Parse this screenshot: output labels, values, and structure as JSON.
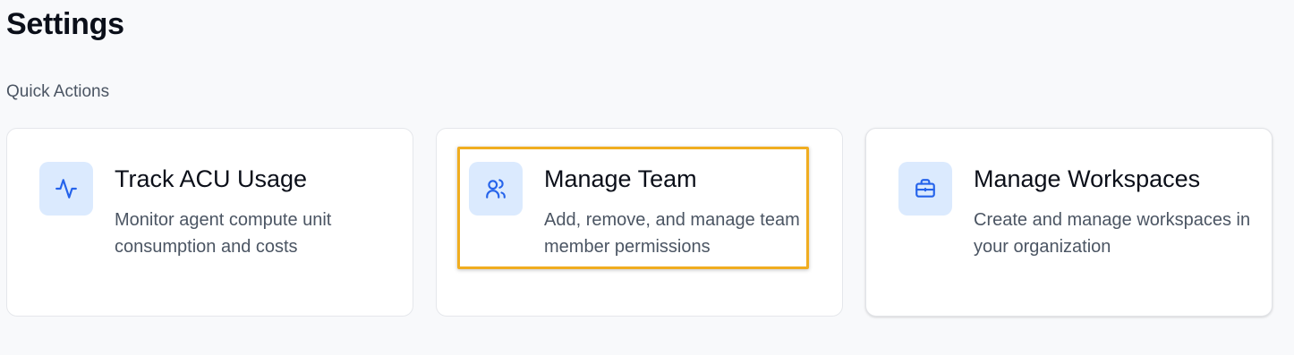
{
  "page": {
    "title": "Settings",
    "section_label": "Quick Actions"
  },
  "cards": [
    {
      "title": "Track ACU Usage",
      "description": "Monitor agent compute unit consumption and costs",
      "icon": "activity-icon"
    },
    {
      "title": "Manage Team",
      "description": "Add, remove, and manage team member permissions",
      "icon": "users-icon"
    },
    {
      "title": "Manage Workspaces",
      "description": "Create and manage workspaces in your organization",
      "icon": "briefcase-icon"
    }
  ],
  "colors": {
    "icon_tile_bg": "#dbeafe",
    "icon_stroke": "#2563eb",
    "highlight": "#f0ad20"
  }
}
